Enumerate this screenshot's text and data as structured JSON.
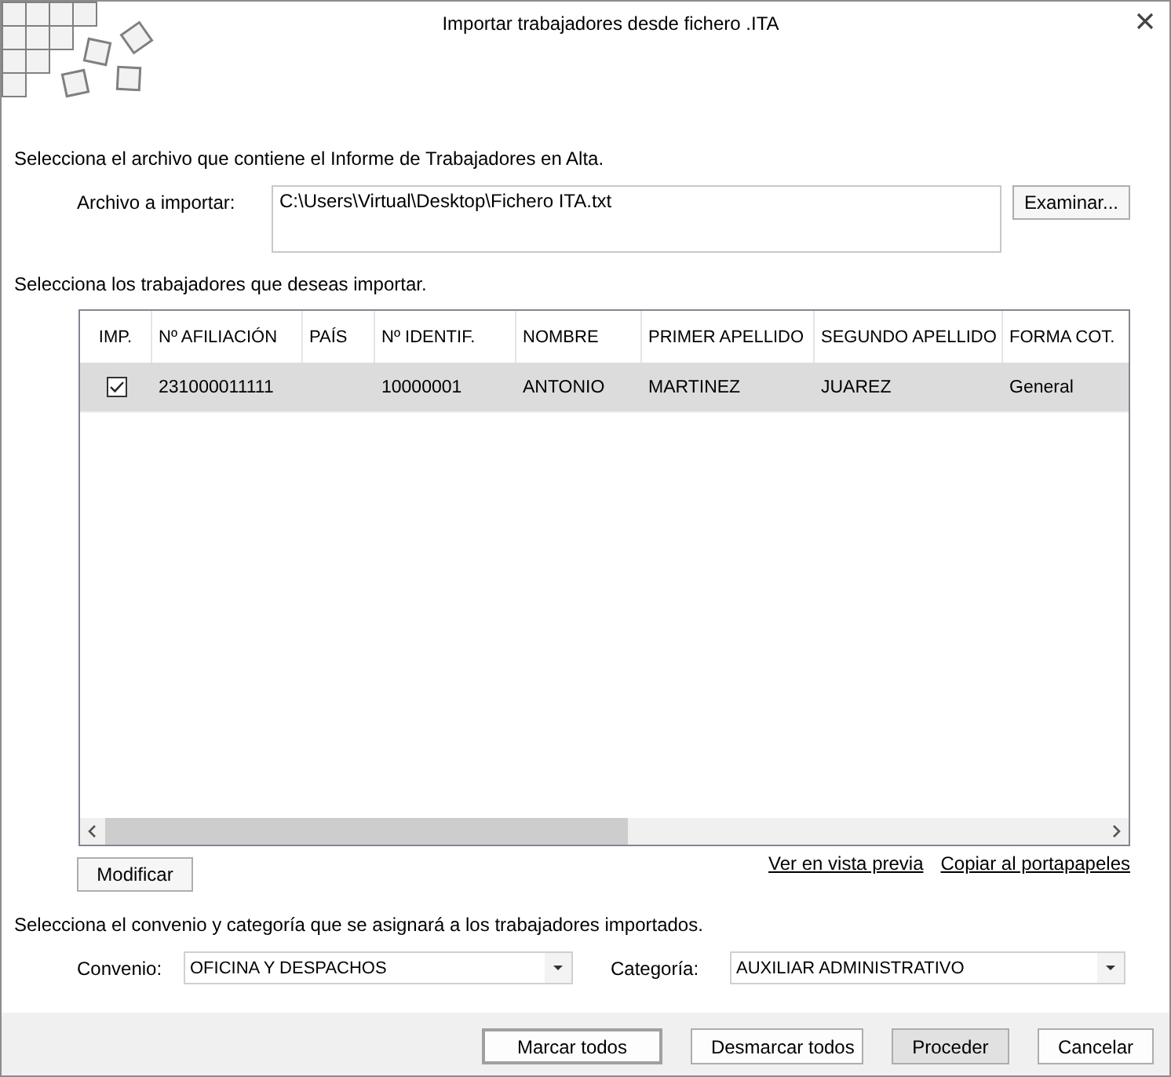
{
  "window": {
    "title": "Importar trabajadores desde fichero .ITA"
  },
  "file_import": {
    "instruction": "Selecciona el archivo que contiene el Informe de Trabajadores en Alta.",
    "label": "Archivo a importar:",
    "value": "C:\\Users\\Virtual\\Desktop\\Fichero ITA.txt",
    "browse_button": "Examinar..."
  },
  "table": {
    "instruction": "Selecciona los trabajadores que deseas importar.",
    "columns": [
      "IMP.",
      "Nº AFILIACIÓN",
      "PAÍS",
      "Nº IDENTIF.",
      "NOMBRE",
      "PRIMER APELLIDO",
      "SEGUNDO APELLIDO",
      "FORMA COT."
    ],
    "rows": [
      {
        "selected": true,
        "checked": true,
        "cells": [
          "",
          "231000011111",
          "",
          "10000001",
          "ANTONIO",
          "MARTINEZ",
          "JUAREZ",
          "General"
        ]
      }
    ]
  },
  "table_actions": {
    "modify_button": "Modificar",
    "links": [
      "Ver en vista previa",
      "Copiar al portapapeles"
    ]
  },
  "assignment": {
    "instruction": "Selecciona el convenio y categoría que se asignará a los trabajadores importados.",
    "fields": [
      {
        "label": "Convenio:",
        "value": "OFICINA Y DESPACHOS"
      },
      {
        "label": "Categoría:",
        "value": "AUXILIAR ADMINISTRATIVO"
      }
    ]
  },
  "buttons": [
    {
      "label": "Marcar todos",
      "focused": true,
      "highlighted": false
    },
    {
      "label": "Desmarcar todos",
      "focused": false,
      "highlighted": false
    },
    {
      "label": "Proceder",
      "focused": false,
      "highlighted": true
    },
    {
      "label": "Cancelar",
      "focused": false,
      "highlighted": false
    }
  ]
}
